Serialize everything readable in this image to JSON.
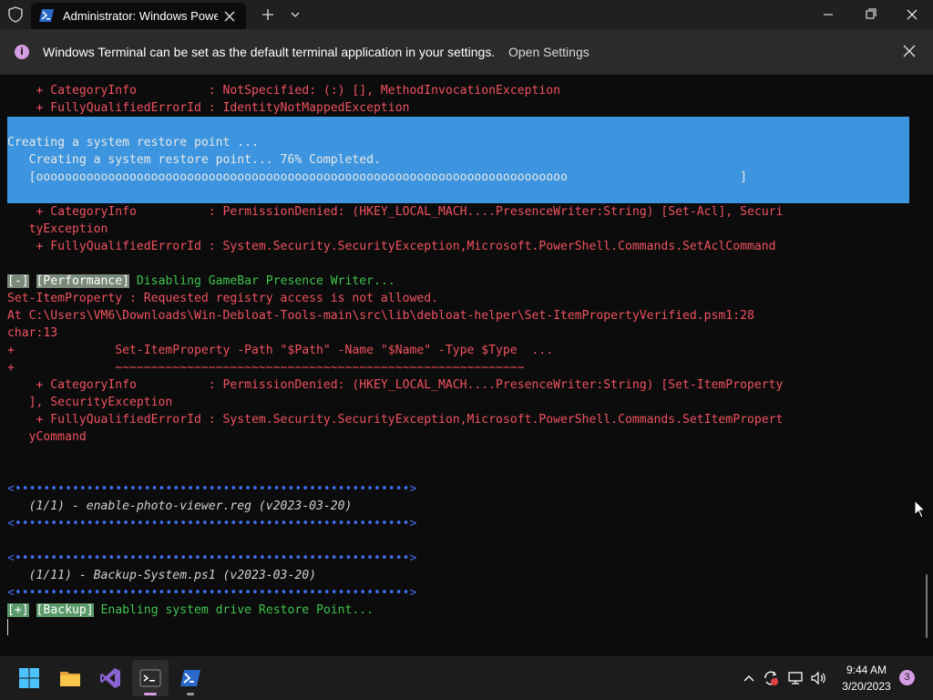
{
  "window": {
    "tab_title": "Administrator: Windows PowerShell",
    "new_tab_symbol": "+",
    "icons": [
      "shield-icon",
      "powershell-icon",
      "close-icon",
      "plus-icon",
      "chevron-down-icon",
      "minimize-icon",
      "maximize-icon",
      "close-window-icon"
    ]
  },
  "infobar": {
    "icon": "i",
    "message": "Windows Terminal can be set as the default terminal application in your settings.",
    "link": "Open Settings"
  },
  "terminal": {
    "l1": "    + CategoryInfo          : NotSpecified: (:) [], MethodInvocationException",
    "l2": "    + FullyQualifiedErrorId : IdentityNotMappedException",
    "p1": "Creating a system restore point ...",
    "p2": "   Creating a system restore point... 76% Completed.",
    "p3": "   [oooooooooooooooooooooooooooooooooooooooooooooooooooooooooooooooooooooooooo                        ]",
    "l3": "    + CategoryInfo          : PermissionDenied: (HKEY_LOCAL_MACH....PresenceWriter:String) [Set-Acl], Securi",
    "l4": "   tyException",
    "l5": "    + FullyQualifiedErrorId : System.Security.SecurityException,Microsoft.PowerShell.Commands.SetAclCommand",
    "perf_tag1": "[-]",
    "perf_tag2": "[Performance]",
    "perf_msg": " Disabling GameBar Presence Writer...",
    "l6": "Set-ItemProperty : Requested registry access is not allowed.",
    "l7": "At C:\\Users\\VM6\\Downloads\\Win-Debloat-Tools-main\\src\\lib\\debloat-helper\\Set-ItemPropertyVerified.psm1:28",
    "l8": "char:13",
    "l9": "+              Set-ItemProperty -Path \"$Path\" -Name \"$Name\" -Type $Type  ...",
    "l10": "+              ~~~~~~~~~~~~~~~~~~~~~~~~~~~~~~~~~~~~~~~~~~~~~~~~~~~~~~~~~",
    "l11": "    + CategoryInfo          : PermissionDenied: (HKEY_LOCAL_MACH....PresenceWriter:String) [Set-ItemProperty",
    "l12": "   ], SecurityException",
    "l13": "    + FullyQualifiedErrorId : System.Security.SecurityException,Microsoft.PowerShell.Commands.SetItemPropert",
    "l14": "   yCommand",
    "sep": "<•••••••••••••••••••••••••••••••••••••••••••••••••••••••>",
    "reg_line": "   (1/1) - enable-photo-viewer.reg (v2023-03-20)",
    "ps_line": "   (1/11) - Backup-System.ps1 (v2023-03-20)",
    "backup_tag1": "[+]",
    "backup_tag2": "[Backup]",
    "backup_msg": " Enabling system drive Restore Point..."
  },
  "taskbar": {
    "apps": [
      "windows-start-icon",
      "file-explorer-icon",
      "visual-studio-icon",
      "terminal-icon",
      "powershell-icon"
    ],
    "tray_icons": [
      "chevron-up-icon",
      "sync-icon",
      "network-icon",
      "volume-icon"
    ],
    "time": "9:44 AM",
    "date": "3/20/2023",
    "notifications": "3"
  },
  "colors": {
    "terminal_bg": "#0c0c0c",
    "error_red": "#f0525f",
    "progress_bg": "#3c95de",
    "accent_pink": "#d49ce4",
    "success_green": "#3fc34f",
    "separator_blue": "#4070f0"
  }
}
